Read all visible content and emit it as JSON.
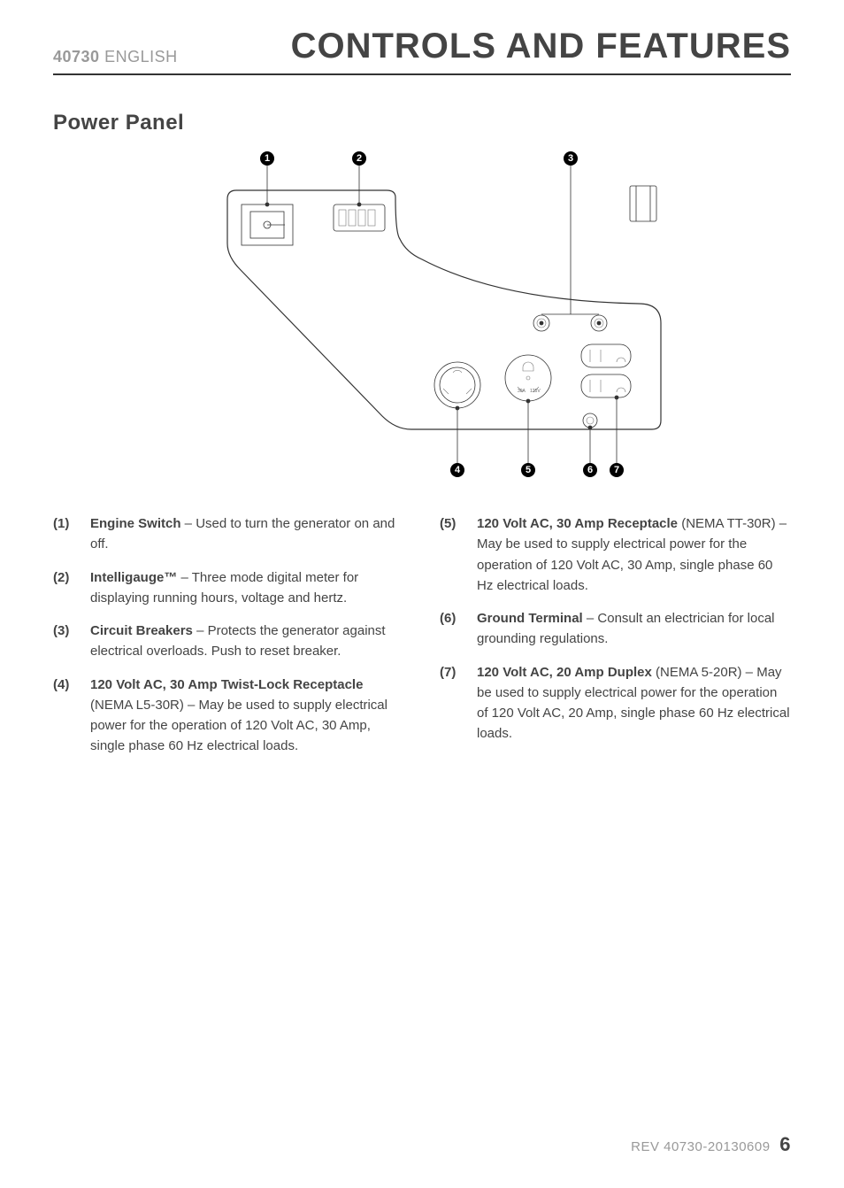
{
  "header": {
    "doc_number": "40730",
    "language": "ENGLISH",
    "page_title": "CONTROLS AND FEATURES"
  },
  "subheading": "Power Panel",
  "diagram": {
    "callouts": [
      "1",
      "2",
      "3",
      "4",
      "5",
      "6",
      "7"
    ],
    "receptacle_label_line1": "30A",
    "receptacle_label_line2": "125V"
  },
  "items_left": [
    {
      "num": "(1)",
      "bold": "Engine Switch",
      "rest": " – Used to turn the generator on and off."
    },
    {
      "num": "(2)",
      "bold": "Intelligauge™",
      "rest": " – Three mode digital meter for displaying running hours, voltage and hertz."
    },
    {
      "num": "(3)",
      "bold": "Circuit Breakers",
      "rest": " – Protects the generator against electrical overloads. Push to reset breaker."
    },
    {
      "num": "(4)",
      "bold": "120 Volt AC, 30 Amp Twist-Lock Receptacle",
      "rest": " (NEMA L5-30R) – May be used to supply electrical power for the operation of 120 Volt AC, 30 Amp, single phase 60 Hz electrical loads."
    }
  ],
  "items_right": [
    {
      "num": "(5)",
      "bold": "120 Volt AC, 30 Amp Receptacle",
      "rest": " (NEMA TT-30R) – May be used to supply electrical power for the operation of 120 Volt AC, 30 Amp, single phase 60 Hz electrical loads."
    },
    {
      "num": "(6)",
      "bold": "Ground Terminal",
      "rest": " – Consult an electrician for local grounding regulations."
    },
    {
      "num": "(7)",
      "bold": "120 Volt AC, 20 Amp Duplex",
      "rest": " (NEMA 5-20R) – May be used to supply electrical power for the operation of 120 Volt AC, 20 Amp, single phase 60 Hz electrical loads."
    }
  ],
  "footer": {
    "rev": "REV 40730-20130609",
    "page_number": "6"
  }
}
